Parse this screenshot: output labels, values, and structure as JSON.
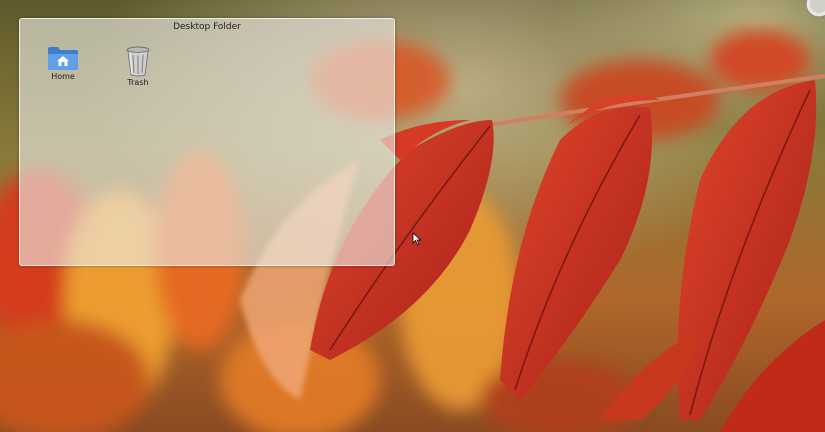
{
  "folder_view": {
    "title": "Desktop Folder",
    "items": [
      {
        "label": "Home",
        "icon": "home-folder-icon"
      },
      {
        "label": "Trash",
        "icon": "trash-icon"
      }
    ]
  },
  "colors": {
    "folder_blue": "#4a90d9",
    "leaf_red": "#c8321a",
    "leaf_orange": "#e8862a",
    "background_olive": "#7d7438"
  }
}
